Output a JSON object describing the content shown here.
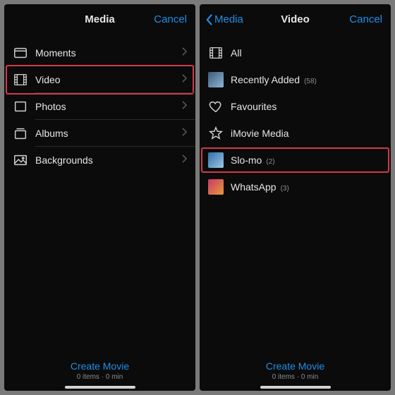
{
  "colors": {
    "accent": "#1f8fe8",
    "highlight": "#d13a4a"
  },
  "left": {
    "nav": {
      "title": "Media",
      "cancel": "Cancel"
    },
    "rows": [
      {
        "key": "moments",
        "label": "Moments",
        "icon": "card"
      },
      {
        "key": "video",
        "label": "Video",
        "icon": "film",
        "highlight": true
      },
      {
        "key": "photos",
        "label": "Photos",
        "icon": "rect"
      },
      {
        "key": "albums",
        "label": "Albums",
        "icon": "stack"
      },
      {
        "key": "backgrounds",
        "label": "Backgrounds",
        "icon": "picture"
      }
    ],
    "footer": {
      "create_label": "Create Movie",
      "meta": "0 items · 0 min"
    }
  },
  "right": {
    "nav": {
      "title": "Video",
      "back_label": "Media",
      "cancel": "Cancel"
    },
    "rows": [
      {
        "key": "all",
        "label": "All",
        "icon": "film"
      },
      {
        "key": "recent",
        "label": "Recently Added",
        "count": "(58)",
        "thumb": "recent"
      },
      {
        "key": "fav",
        "label": "Favourites",
        "icon": "heart"
      },
      {
        "key": "imovie",
        "label": "iMovie Media",
        "icon": "star"
      },
      {
        "key": "slomo",
        "label": "Slo-mo",
        "count": "(2)",
        "thumb": "slomo",
        "highlight": true
      },
      {
        "key": "whatsapp",
        "label": "WhatsApp",
        "count": "(3)",
        "thumb": "whatsapp"
      }
    ],
    "footer": {
      "create_label": "Create Movie",
      "meta": "0 items · 0 min"
    }
  }
}
